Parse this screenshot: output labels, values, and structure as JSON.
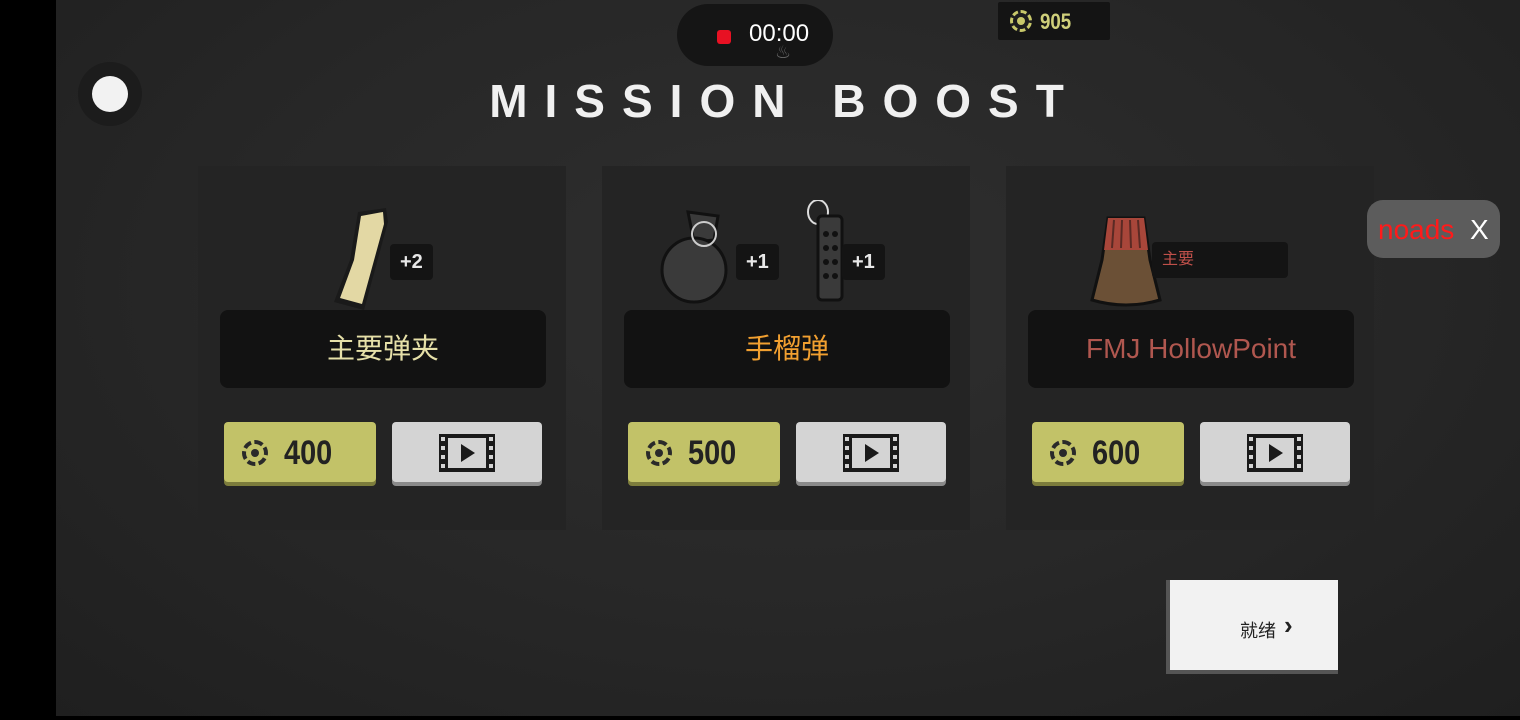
{
  "recording": {
    "time": "00:00"
  },
  "currency": {
    "icon": "coin-icon",
    "balance": "905"
  },
  "title": "MISSION BOOST",
  "cards": [
    {
      "name": "主要弹夹",
      "name_color": "#e6e0a8",
      "badges": [
        "+2"
      ],
      "price": "400",
      "video_icon": "film-play-icon"
    },
    {
      "name": "手榴弹",
      "name_color": "#f2a030",
      "badges": [
        "+1",
        "+1"
      ],
      "price": "500",
      "video_icon": "film-play-icon"
    },
    {
      "name": "FMJ HollowPoint",
      "name_color": "#b0574f",
      "badges": [
        "主要"
      ],
      "price": "600",
      "video_icon": "film-play-icon"
    }
  ],
  "ready_button": {
    "label": "就绪",
    "icon": "chevron-right-icon"
  },
  "noads": {
    "label": "noads",
    "close": "X"
  },
  "colors": {
    "accent": "#c2c268",
    "coin": "#c8c86a",
    "background": "#2a2a2a"
  }
}
